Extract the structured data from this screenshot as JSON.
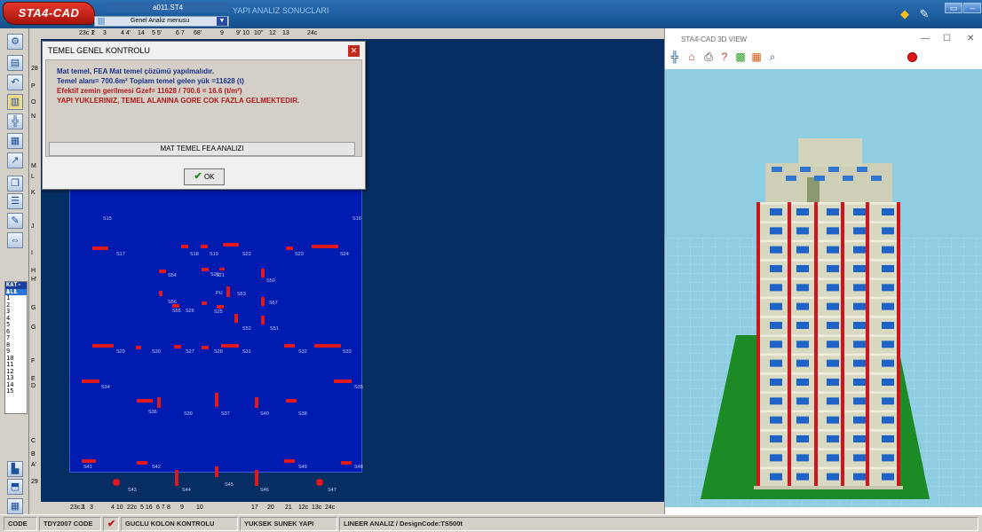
{
  "app": {
    "logo": "STA4-CAD",
    "filename": "a011.ST4",
    "menu": "Genel Analiz menusu",
    "results_title": "YAPI ANALIZ SONUCLARI"
  },
  "rulers": {
    "top": [
      "23c 1",
      "2",
      "3",
      "4 4'",
      "14",
      "5 5'",
      "6 7",
      "68'",
      "9",
      "9' 10",
      "10''",
      "12",
      "13",
      "24c"
    ],
    "bottom": [
      "23c 1",
      "2",
      "3",
      "4 10",
      "22c",
      "5 16",
      "6 7",
      "8",
      "9",
      "10",
      "17",
      "20",
      "21",
      "12c",
      "13c",
      "24c"
    ],
    "left": [
      "28",
      "P",
      "O",
      "N",
      "M",
      "L",
      "K",
      "J",
      "I",
      "H",
      "H'",
      "G",
      "G",
      "F",
      "E",
      "D",
      "C",
      "B",
      "A'",
      "29"
    ]
  },
  "story_list": {
    "header": "KAT-ALL",
    "selected": "1.1",
    "items": [
      "1",
      "2",
      "3",
      "4",
      "5",
      "6",
      "7",
      "8",
      "9",
      "10",
      "11",
      "12",
      "13",
      "14",
      "15"
    ]
  },
  "plan": {
    "labels": [
      "S15",
      "S16",
      "S17",
      "S18",
      "S19",
      "S22",
      "S23",
      "S24",
      "S20",
      "S21",
      "S54",
      "S50",
      "S53",
      "S56",
      "S55",
      "S26",
      "S25",
      "S57",
      "S52",
      "S51",
      "S29",
      "S30",
      "S27",
      "S28",
      "S31",
      "S32",
      "S33",
      "S34",
      "S35",
      "S36",
      "S39",
      "S37",
      "S40",
      "S38",
      "S41",
      "S42",
      "S49",
      "S48",
      "S43",
      "S44",
      "S45",
      "S46",
      "S47"
    ],
    "mark_pu": "PU"
  },
  "dialog": {
    "title": "TEMEL GENEL KONTROLU",
    "line1": "Mat temel, FEA Mat temel çözümü yapılmalıdır.",
    "line2": "Temel alanı= 700.6m²  Toplam temel gelen yük =11628 (t)",
    "line3": "Efektif zemin gerilmesi  Gzef= 11628 / 700.6 = 16.6 (t/m²)",
    "line4": "  YAPI YUKLERINIZ, TEMEL ALANINA GORE COK FAZLA GELMEKTEDIR.",
    "fea_button": "MAT TEMEL FEA ANALIZI",
    "ok_button": "OK"
  },
  "view3d": {
    "title": "STA4-CAD 3D VIEW",
    "stories": 15
  },
  "statusbar": {
    "code": "CODE",
    "tdy": "TDY2007 CODE",
    "column_check": "GUCLU KOLON KONTROLU",
    "ductility": "YUKSEK SUNEK YAPI",
    "analysis": "LINEER ANALIZ / DesignCode:TS500t"
  }
}
